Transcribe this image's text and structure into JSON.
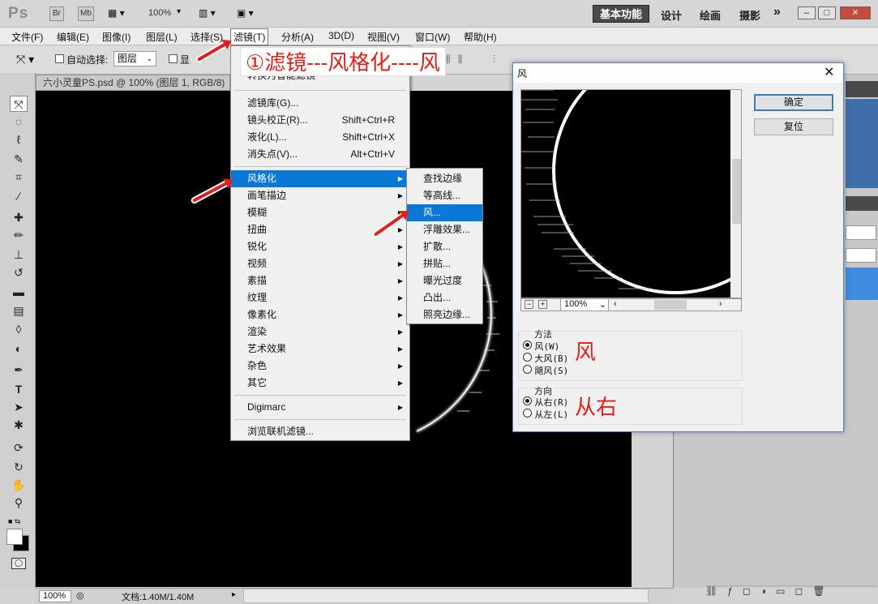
{
  "app": {
    "logo": "Ps",
    "br": "Br",
    "mb": "Mb",
    "zoom": "100%",
    "ws_active": "基本功能",
    "ws_design": "设计",
    "ws_paint": "绘画",
    "ws_photo": "摄影",
    "ws_more": "»"
  },
  "menubar": [
    "文件(F)",
    "编辑(E)",
    "图像(I)",
    "图层(L)",
    "选择(S)",
    "滤镜(T)",
    "分析(A)",
    "3D(D)",
    "视图(V)",
    "窗口(W)",
    "帮助(H)"
  ],
  "options": {
    "auto_select": "自动选择:",
    "layer_select": "图层",
    "show": "显"
  },
  "document": {
    "tab": "六小灵童PS.psd @ 100% (图层 1, RGB/8) *"
  },
  "filter_menu": {
    "top_item": "转换为智能滤镜",
    "items": [
      {
        "label": "滤镜库(G)...",
        "shortcut": ""
      },
      {
        "label": "镜头校正(R)...",
        "shortcut": "Shift+Ctrl+R"
      },
      {
        "label": "液化(L)...",
        "shortcut": "Shift+Ctrl+X"
      },
      {
        "label": "消失点(V)...",
        "shortcut": "Alt+Ctrl+V"
      }
    ],
    "submenus": [
      "风格化",
      "画笔描边",
      "模糊",
      "扭曲",
      "锐化",
      "视频",
      "素描",
      "纹理",
      "像素化",
      "渲染",
      "艺术效果",
      "杂色",
      "其它"
    ],
    "digimarc": "Digimarc",
    "browse": "浏览联机滤镜..."
  },
  "stylize_menu": [
    "查找边缘",
    "等高线...",
    "风...",
    "浮雕效果...",
    "扩散...",
    "拼贴...",
    "曝光过度",
    "凸出...",
    "照亮边缘..."
  ],
  "dialog": {
    "title": "风",
    "ok": "确定",
    "reset": "复位",
    "zoom": "100%",
    "method_label": "方法",
    "methods": [
      "风(W)",
      "大风(B)",
      "飓风(S)"
    ],
    "direction_label": "方向",
    "directions": [
      "从右(R)",
      "从左(L)"
    ]
  },
  "annotations": {
    "main": "①滤镜---风格化----风",
    "wind": "风",
    "from_right": "从右"
  },
  "status": {
    "zoom": "100%",
    "doc": "文档:1.40M/1.40M"
  },
  "colors": {
    "highlight": "#0a78d7",
    "annotation": "#e0201a"
  }
}
